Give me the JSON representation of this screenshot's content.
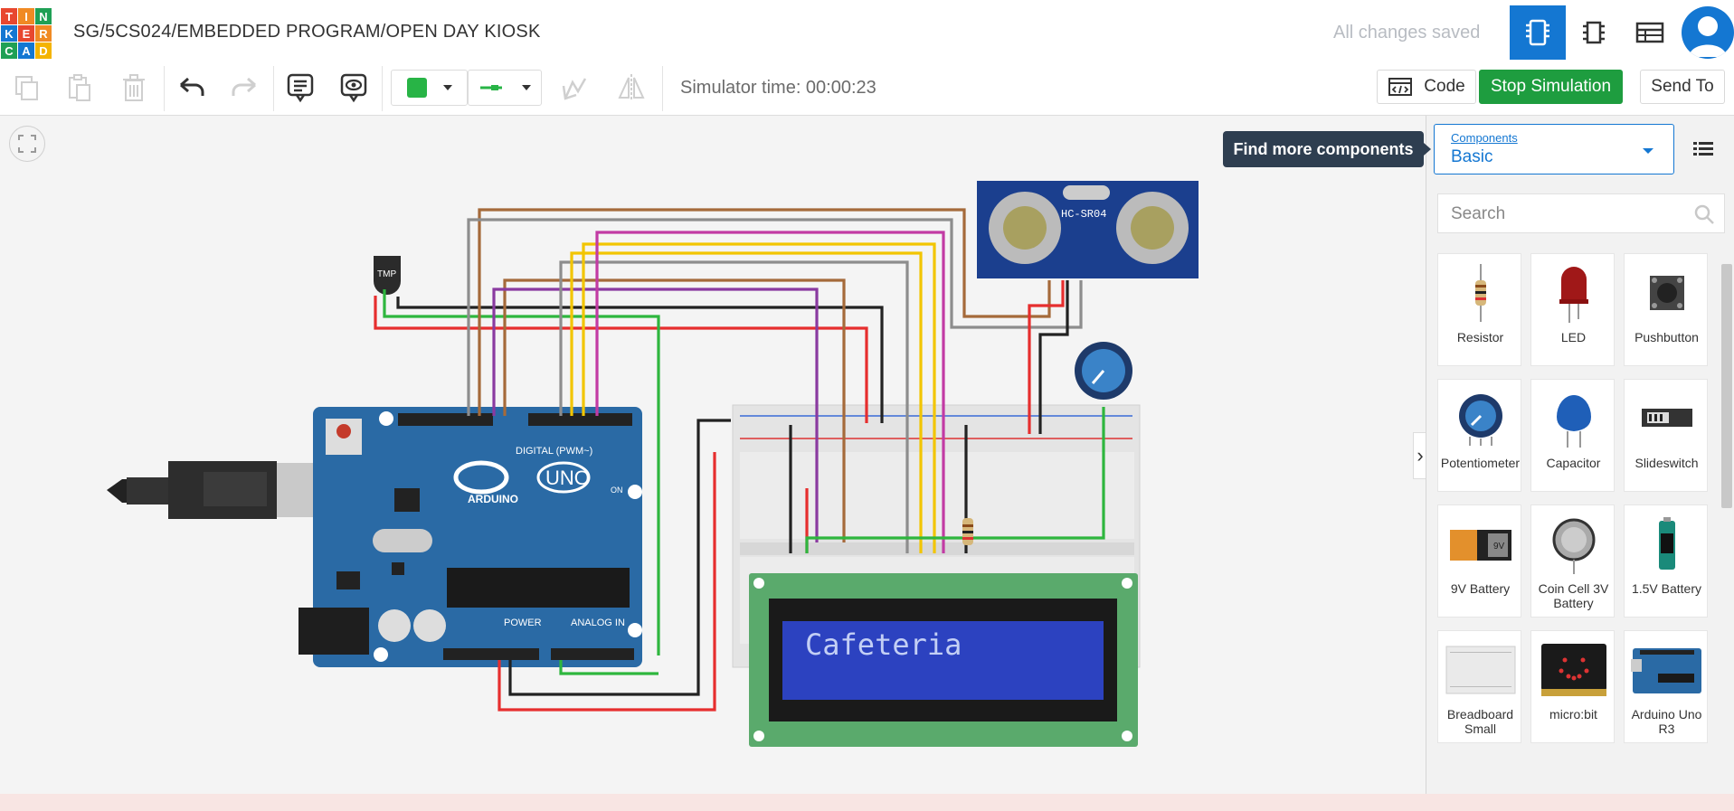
{
  "header": {
    "logo_letters": [
      "T",
      "I",
      "N",
      "K",
      "E",
      "R",
      "C",
      "A",
      "D"
    ],
    "logo_colors": [
      "#e8472f",
      "#f08a24",
      "#1fa055",
      "#1477d2",
      "#e8472f",
      "#f08a24",
      "#1fa055",
      "#1477d2",
      "#f4b400"
    ],
    "title": "SG/5CS024/EMBEDDED PROGRAM/OPEN DAY KIOSK",
    "save_status": "All changes saved",
    "view_buttons": [
      "circuit-view-icon",
      "schematic-view-icon",
      "component-list-icon"
    ],
    "accent": "#1477d2"
  },
  "toolbar": {
    "simulator_time": "Simulator time: 00:00:23",
    "code_label": "Code",
    "stop_label": "Stop Simulation",
    "send_label": "Send To",
    "wire_color": "#28b446"
  },
  "canvas": {
    "lcd_text": "Cafeteria",
    "sensor_label": "HC-SR04",
    "board_label": "UNO",
    "board_brand": "ARDUINO",
    "board_digital": "DIGITAL (PWM~)",
    "board_power": "POWER",
    "board_analog": "ANALOG IN",
    "board_on": "ON",
    "tmp_label": "TMP"
  },
  "panel": {
    "tooltip": "Find more components",
    "select_label": "Components",
    "select_value": "Basic",
    "search_placeholder": "Search",
    "components": [
      {
        "label": "Resistor",
        "icon": "resistor-icon"
      },
      {
        "label": "LED",
        "icon": "led-icon"
      },
      {
        "label": "Pushbutton",
        "icon": "pushbutton-icon"
      },
      {
        "label": "Potentiometer",
        "icon": "potentiometer-icon"
      },
      {
        "label": "Capacitor",
        "icon": "capacitor-icon"
      },
      {
        "label": "Slideswitch",
        "icon": "slideswitch-icon"
      },
      {
        "label": "9V Battery",
        "icon": "battery-9v-icon"
      },
      {
        "label": "Coin Cell 3V Battery",
        "icon": "coin-cell-icon"
      },
      {
        "label": "1.5V Battery",
        "icon": "battery-aa-icon"
      },
      {
        "label": "Breadboard Small",
        "icon": "breadboard-icon"
      },
      {
        "label": "micro:bit",
        "icon": "microbit-icon"
      },
      {
        "label": "Arduino Uno R3",
        "icon": "arduino-icon"
      }
    ]
  }
}
